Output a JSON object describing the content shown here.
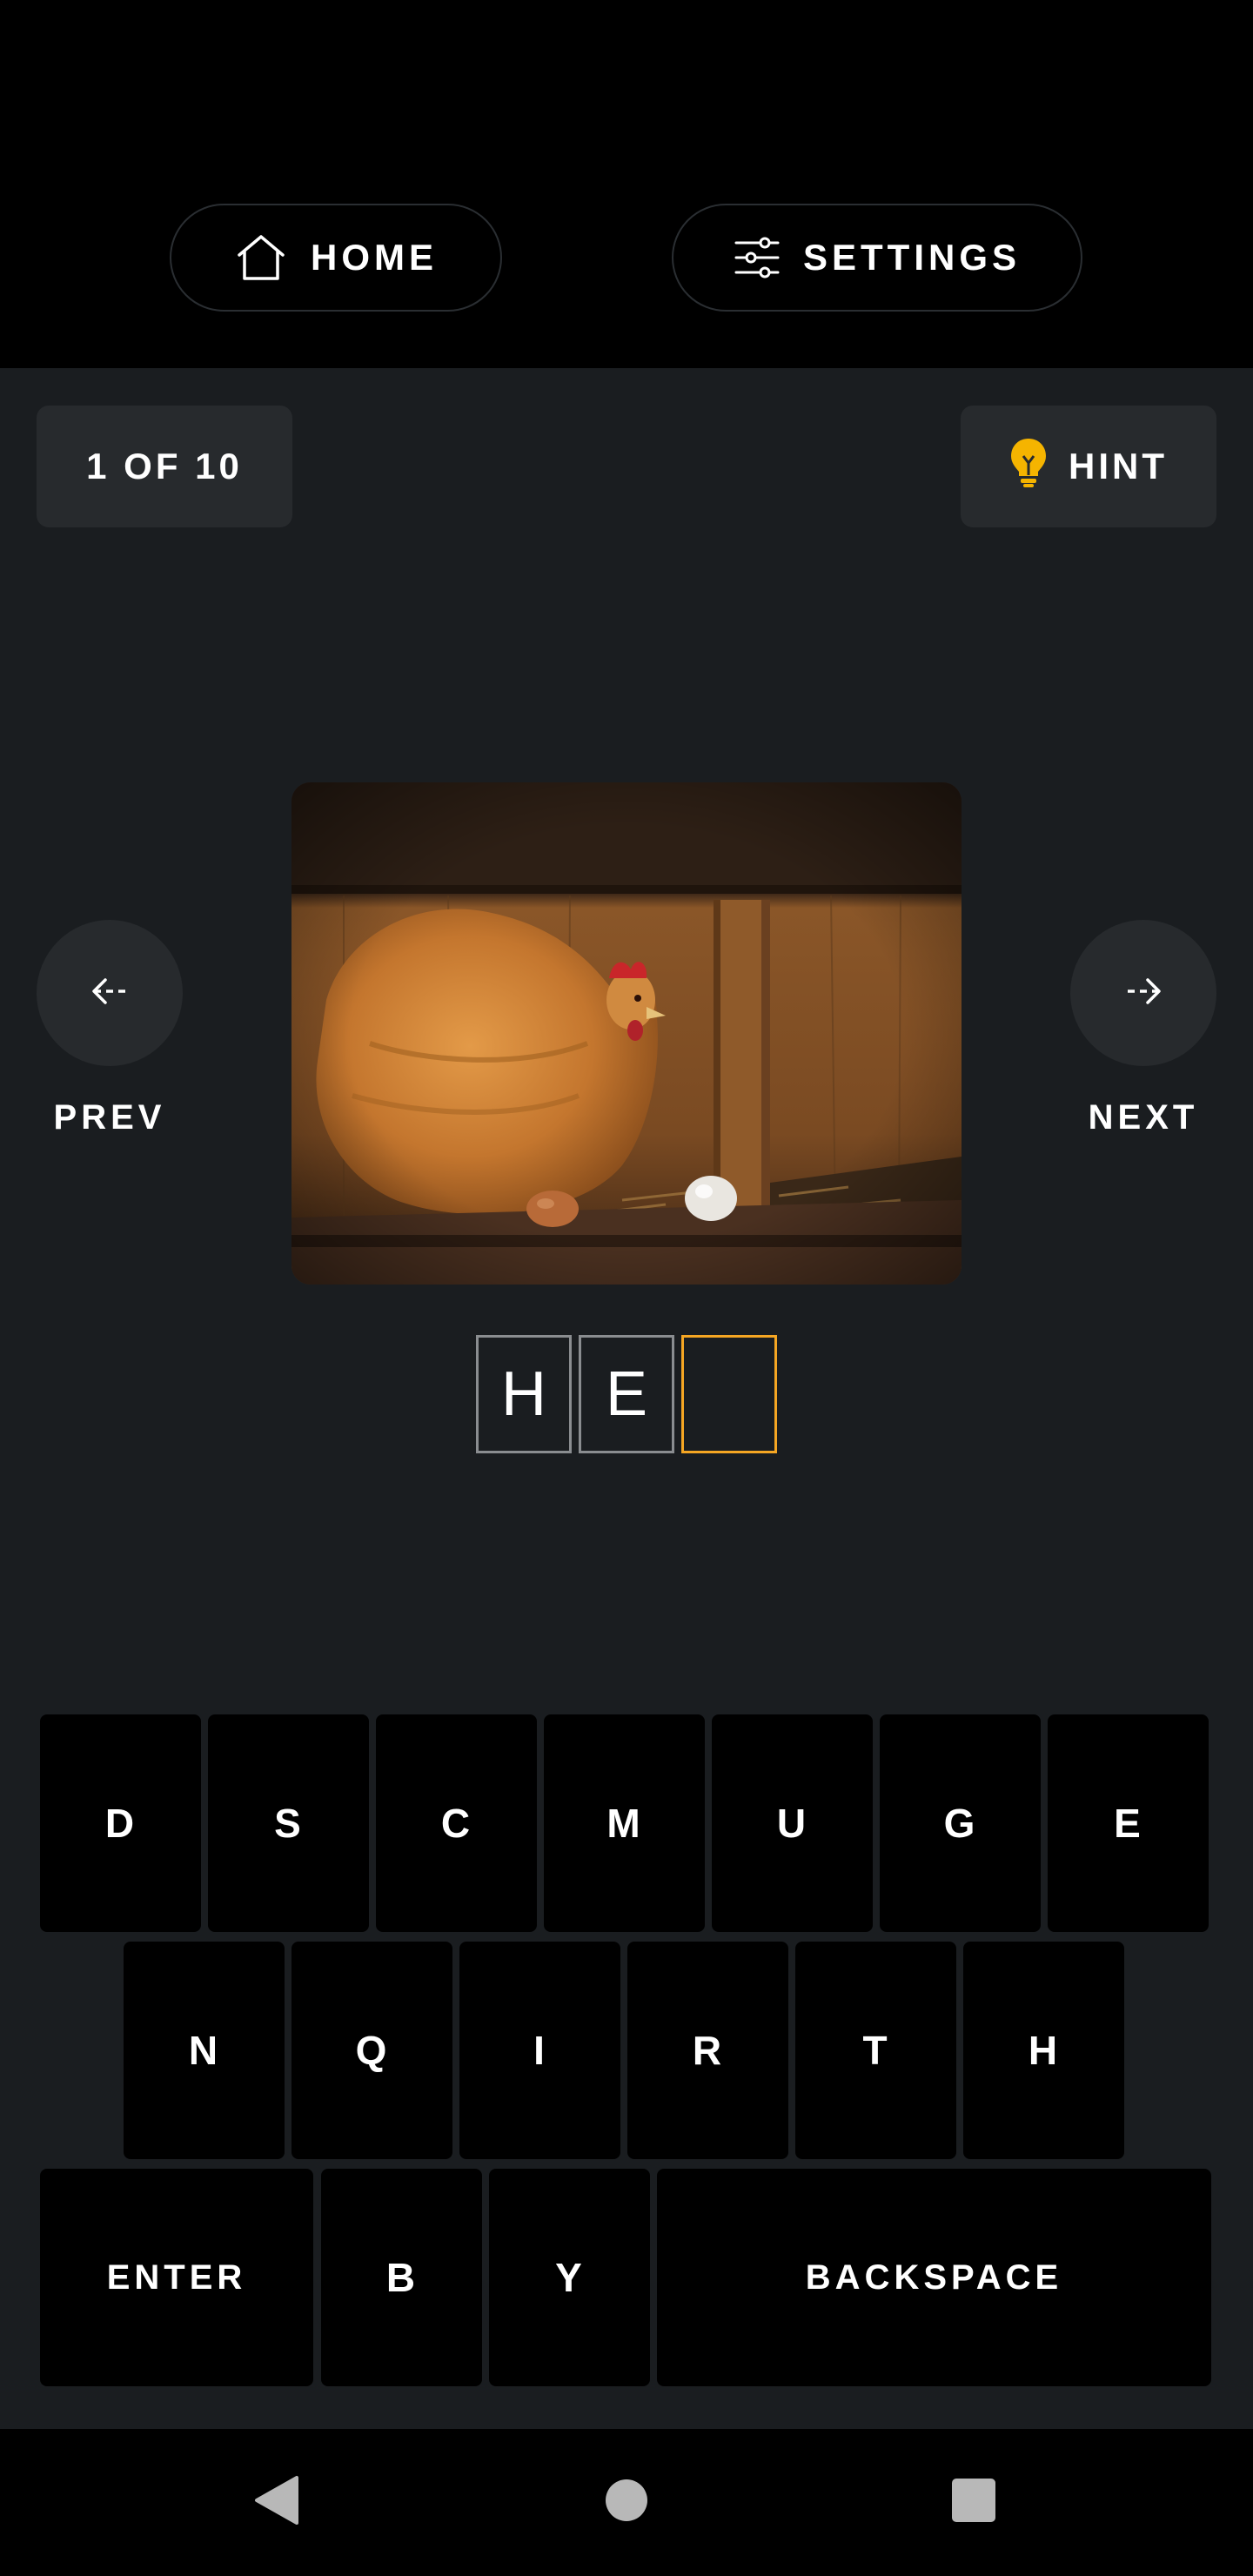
{
  "header": {
    "home_label": "HOME",
    "settings_label": "SETTINGS"
  },
  "progress": {
    "counter_label": "1 OF 10"
  },
  "hint": {
    "label": "HINT",
    "icon": "lightbulb-icon",
    "icon_color": "#f5b400"
  },
  "navigation": {
    "prev_label": "PREV",
    "next_label": "NEXT"
  },
  "puzzle": {
    "image_subject": "hen-in-nest-photo",
    "answer_slots": [
      "H",
      "E",
      ""
    ],
    "active_slot_index": 2,
    "active_color": "#f5a623"
  },
  "keyboard": {
    "row1": [
      "D",
      "S",
      "C",
      "M",
      "U",
      "G",
      "E"
    ],
    "row2": [
      "N",
      "Q",
      "I",
      "R",
      "T",
      "H"
    ],
    "row3": [
      "ENTER",
      "B",
      "Y",
      "BACKSPACE"
    ]
  },
  "system_nav": {
    "back_icon": "back-triangle-icon",
    "home_icon": "home-circle-icon",
    "recents_icon": "recents-square-icon"
  }
}
